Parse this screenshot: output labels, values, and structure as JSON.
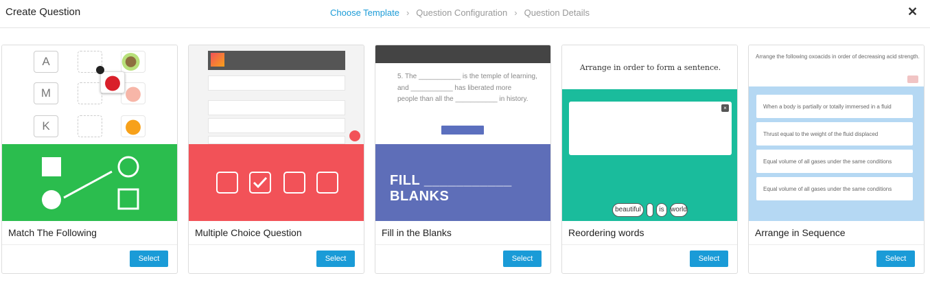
{
  "header": {
    "title": "Create Question",
    "steps": [
      "Choose Template",
      "Question Configuration",
      "Question Details"
    ],
    "close_icon": "close-icon"
  },
  "templates": [
    {
      "title": "Match The Following",
      "select_label": "Select",
      "letters": [
        "A",
        "M",
        "K"
      ]
    },
    {
      "title": "Multiple Choice Question",
      "select_label": "Select"
    },
    {
      "title": "Fill in the Blanks",
      "select_label": "Select",
      "fill_line1": "5. The ___________ is the temple of learning,",
      "fill_line2": "and ___________ has liberated more",
      "fill_line3": "people than all the ___________ in history.",
      "fill_banner": "FILL ___________ BLANKS"
    },
    {
      "title": "Reordering words",
      "select_label": "Select",
      "prompt": "Arrange in order to form a sentence.",
      "words": [
        "beautiful",
        "is",
        "world"
      ]
    },
    {
      "title": "Arrange in Sequence",
      "select_label": "Select",
      "prompt": "Arrange the following oxoacids in order of decreasing acid strength.",
      "items": [
        "When a body is partially or totally immersed in a fluid",
        "Thrust equal to the weight of the fluid displaced",
        "Equal volume of all gases under the same conditions",
        "Equal volume of all gases under the same conditions"
      ]
    }
  ],
  "colors": {
    "accent": "#1a9bd7",
    "match_green": "#2bbd4e",
    "mcq_red": "#f25258",
    "fill_blue": "#5e6eb8",
    "reorder_teal": "#1abc9c",
    "arrange_blue": "#b5d8f3"
  }
}
